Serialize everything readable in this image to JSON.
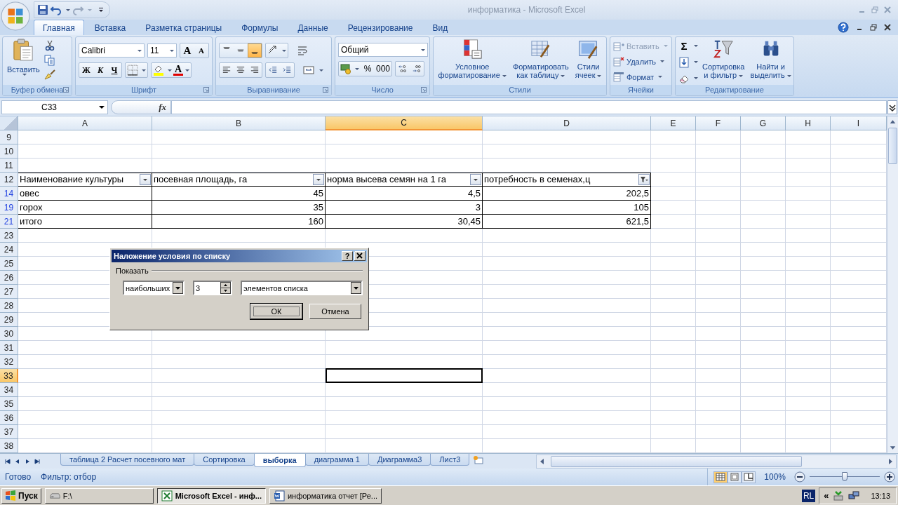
{
  "window": {
    "title": "информатика - Microsoft Excel"
  },
  "tabs": [
    {
      "label": "Главная",
      "selected": true
    },
    {
      "label": "Вставка",
      "selected": false
    },
    {
      "label": "Разметка страницы",
      "selected": false
    },
    {
      "label": "Формулы",
      "selected": false
    },
    {
      "label": "Данные",
      "selected": false
    },
    {
      "label": "Рецензирование",
      "selected": false
    },
    {
      "label": "Вид",
      "selected": false
    }
  ],
  "ribbon": {
    "clipboard": {
      "title": "Буфер обмена",
      "paste": "Вставить"
    },
    "font": {
      "title": "Шрифт",
      "name": "Calibri",
      "size": "11",
      "grow": "A",
      "shrink": "A",
      "bold": "Ж",
      "italic": "К",
      "underline": "Ч",
      "font_color": "A"
    },
    "alignment": {
      "title": "Выравнивание",
      "vertical": [
        {
          "selected": false
        },
        {
          "selected": false
        },
        {
          "selected": true
        }
      ]
    },
    "number": {
      "title": "Число",
      "format": "Общий",
      "percent": "%",
      "thousands": "000"
    },
    "styles": {
      "title": "Стили",
      "buttons": [
        {
          "lines": [
            "Условное",
            "форматирование"
          ]
        },
        {
          "lines": [
            "Форматировать",
            "как таблицу"
          ]
        },
        {
          "lines": [
            "Стили",
            "ячеек"
          ]
        }
      ]
    },
    "cells": {
      "title": "Ячейки",
      "buttons": [
        {
          "label": "Вставить",
          "disabled": true
        },
        {
          "label": "Удалить",
          "disabled": false
        },
        {
          "label": "Формат",
          "disabled": false
        }
      ]
    },
    "editing": {
      "title": "Редактирование",
      "sum": "Σ",
      "sort": [
        "Сортировка",
        "и фильтр"
      ],
      "find": [
        "Найти и",
        "выделить"
      ]
    }
  },
  "formula_bar": {
    "cell": "C33",
    "fx": "fx"
  },
  "sheet": {
    "columns": [
      {
        "label": "A",
        "selected": false
      },
      {
        "label": "B",
        "selected": false
      },
      {
        "label": "C",
        "selected": true
      },
      {
        "label": "D",
        "selected": false
      },
      {
        "label": "E",
        "selected": false
      },
      {
        "label": "F",
        "selected": false
      },
      {
        "label": "G",
        "selected": false
      },
      {
        "label": "H",
        "selected": false
      },
      {
        "label": "I",
        "selected": false
      }
    ],
    "rows": [
      {
        "number": "9",
        "filtered": false,
        "selected": false
      },
      {
        "number": "10",
        "filtered": false,
        "selected": false
      },
      {
        "number": "11",
        "filtered": false,
        "selected": false
      },
      {
        "number": "12",
        "filtered": false,
        "selected": false,
        "cells": [
          {
            "text": "Наименование культуры",
            "kind": "header",
            "filter_applied": false
          },
          {
            "text": "посевная площадь, га",
            "kind": "header",
            "filter_applied": false
          },
          {
            "text": "норма высева семян на 1 га",
            "kind": "header",
            "filter_applied": false
          },
          {
            "text": "потребность в семенах,ц",
            "kind": "header",
            "filter_applied": true
          }
        ]
      },
      {
        "number": "14",
        "filtered": true,
        "selected": false,
        "cells": [
          {
            "text": "овес",
            "kind": "text"
          },
          {
            "text": "45",
            "kind": "number"
          },
          {
            "text": "4,5",
            "kind": "number"
          },
          {
            "text": "202,5",
            "kind": "number"
          }
        ]
      },
      {
        "number": "19",
        "filtered": true,
        "selected": false,
        "cells": [
          {
            "text": "горох",
            "kind": "text"
          },
          {
            "text": "35",
            "kind": "number"
          },
          {
            "text": "3",
            "kind": "number"
          },
          {
            "text": "105",
            "kind": "number"
          }
        ]
      },
      {
        "number": "21",
        "filtered": true,
        "selected": false,
        "cells": [
          {
            "text": "итого",
            "kind": "text"
          },
          {
            "text": "160",
            "kind": "number"
          },
          {
            "text": "30,45",
            "kind": "number"
          },
          {
            "text": "621,5",
            "kind": "number"
          }
        ]
      },
      {
        "number": "23",
        "filtered": false,
        "selected": false
      },
      {
        "number": "24",
        "filtered": false,
        "selected": false
      },
      {
        "number": "25",
        "filtered": false,
        "selected": false
      },
      {
        "number": "26",
        "filtered": false,
        "selected": false
      },
      {
        "number": "27",
        "filtered": false,
        "selected": false
      },
      {
        "number": "28",
        "filtered": false,
        "selected": false
      },
      {
        "number": "29",
        "filtered": false,
        "selected": false
      },
      {
        "number": "30",
        "filtered": false,
        "selected": false
      },
      {
        "number": "31",
        "filtered": false,
        "selected": false
      },
      {
        "number": "32",
        "filtered": false,
        "selected": false
      },
      {
        "number": "33",
        "filtered": false,
        "selected": true
      },
      {
        "number": "34",
        "filtered": false,
        "selected": false
      },
      {
        "number": "35",
        "filtered": false,
        "selected": false
      },
      {
        "number": "36",
        "filtered": false,
        "selected": false
      },
      {
        "number": "37",
        "filtered": false,
        "selected": false
      },
      {
        "number": "38",
        "filtered": false,
        "selected": false
      }
    ]
  },
  "dialog": {
    "title": "Наложение условия по списку",
    "help": "?",
    "section": "Показать",
    "mode": "наибольших",
    "count": "3",
    "unit": "элементов списка",
    "buttons": [
      {
        "label": "ОК",
        "default": true
      },
      {
        "label": "Отмена",
        "default": false
      }
    ]
  },
  "sheet_tabs": [
    {
      "label": "таблица 2 Расчет посевного мат",
      "selected": false
    },
    {
      "label": "Сортировка",
      "selected": false
    },
    {
      "label": "выборка",
      "selected": true
    },
    {
      "label": "диаграмма 1",
      "selected": false
    },
    {
      "label": "Диаграмма3",
      "selected": false
    },
    {
      "label": "Лист3",
      "selected": false
    }
  ],
  "status_bar": {
    "ready": "Готово",
    "filter": "Фильтр: отбор",
    "views": [
      {
        "selected": true
      },
      {
        "selected": false
      },
      {
        "selected": false
      }
    ],
    "zoom": "100%",
    "zoom_slider": {
      "level": 0.5
    }
  },
  "taskbar": {
    "start": "Пуск",
    "buttons": [
      {
        "label": "F:\\",
        "selected": false
      },
      {
        "label": "Microsoft Excel - инф...",
        "selected": true
      },
      {
        "label": "информатика отчет [Ре...",
        "selected": false
      }
    ],
    "language": "RL",
    "tray_toggle": "«",
    "clock": "13:13"
  }
}
